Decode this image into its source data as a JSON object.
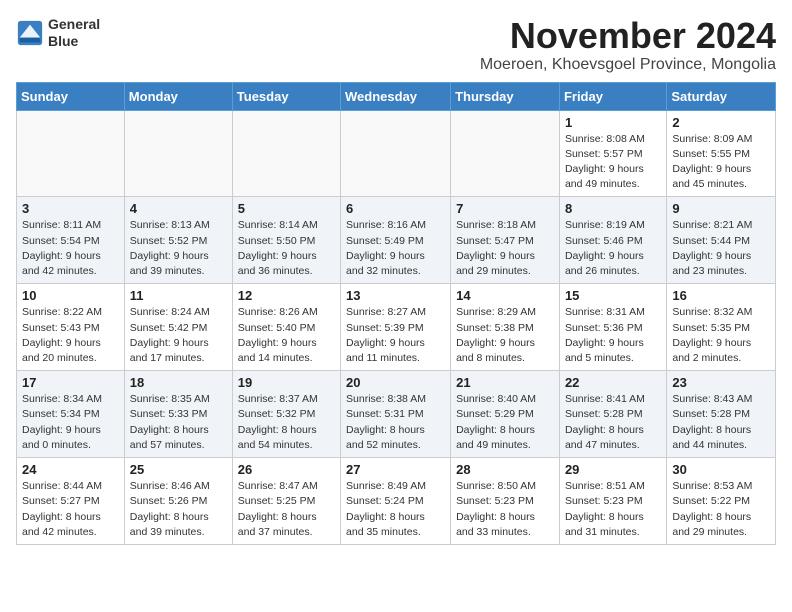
{
  "header": {
    "logo_line1": "General",
    "logo_line2": "Blue",
    "month_title": "November 2024",
    "subtitle": "Moeroen, Khoevsgoel Province, Mongolia"
  },
  "weekdays": [
    "Sunday",
    "Monday",
    "Tuesday",
    "Wednesday",
    "Thursday",
    "Friday",
    "Saturday"
  ],
  "weeks": [
    [
      {
        "day": "",
        "info": "",
        "empty": true
      },
      {
        "day": "",
        "info": "",
        "empty": true
      },
      {
        "day": "",
        "info": "",
        "empty": true
      },
      {
        "day": "",
        "info": "",
        "empty": true
      },
      {
        "day": "",
        "info": "",
        "empty": true
      },
      {
        "day": "1",
        "info": "Sunrise: 8:08 AM\nSunset: 5:57 PM\nDaylight: 9 hours and 49 minutes."
      },
      {
        "day": "2",
        "info": "Sunrise: 8:09 AM\nSunset: 5:55 PM\nDaylight: 9 hours and 45 minutes."
      }
    ],
    [
      {
        "day": "3",
        "info": "Sunrise: 8:11 AM\nSunset: 5:54 PM\nDaylight: 9 hours and 42 minutes."
      },
      {
        "day": "4",
        "info": "Sunrise: 8:13 AM\nSunset: 5:52 PM\nDaylight: 9 hours and 39 minutes."
      },
      {
        "day": "5",
        "info": "Sunrise: 8:14 AM\nSunset: 5:50 PM\nDaylight: 9 hours and 36 minutes."
      },
      {
        "day": "6",
        "info": "Sunrise: 8:16 AM\nSunset: 5:49 PM\nDaylight: 9 hours and 32 minutes."
      },
      {
        "day": "7",
        "info": "Sunrise: 8:18 AM\nSunset: 5:47 PM\nDaylight: 9 hours and 29 minutes."
      },
      {
        "day": "8",
        "info": "Sunrise: 8:19 AM\nSunset: 5:46 PM\nDaylight: 9 hours and 26 minutes."
      },
      {
        "day": "9",
        "info": "Sunrise: 8:21 AM\nSunset: 5:44 PM\nDaylight: 9 hours and 23 minutes."
      }
    ],
    [
      {
        "day": "10",
        "info": "Sunrise: 8:22 AM\nSunset: 5:43 PM\nDaylight: 9 hours and 20 minutes."
      },
      {
        "day": "11",
        "info": "Sunrise: 8:24 AM\nSunset: 5:42 PM\nDaylight: 9 hours and 17 minutes."
      },
      {
        "day": "12",
        "info": "Sunrise: 8:26 AM\nSunset: 5:40 PM\nDaylight: 9 hours and 14 minutes."
      },
      {
        "day": "13",
        "info": "Sunrise: 8:27 AM\nSunset: 5:39 PM\nDaylight: 9 hours and 11 minutes."
      },
      {
        "day": "14",
        "info": "Sunrise: 8:29 AM\nSunset: 5:38 PM\nDaylight: 9 hours and 8 minutes."
      },
      {
        "day": "15",
        "info": "Sunrise: 8:31 AM\nSunset: 5:36 PM\nDaylight: 9 hours and 5 minutes."
      },
      {
        "day": "16",
        "info": "Sunrise: 8:32 AM\nSunset: 5:35 PM\nDaylight: 9 hours and 2 minutes."
      }
    ],
    [
      {
        "day": "17",
        "info": "Sunrise: 8:34 AM\nSunset: 5:34 PM\nDaylight: 9 hours and 0 minutes."
      },
      {
        "day": "18",
        "info": "Sunrise: 8:35 AM\nSunset: 5:33 PM\nDaylight: 8 hours and 57 minutes."
      },
      {
        "day": "19",
        "info": "Sunrise: 8:37 AM\nSunset: 5:32 PM\nDaylight: 8 hours and 54 minutes."
      },
      {
        "day": "20",
        "info": "Sunrise: 8:38 AM\nSunset: 5:31 PM\nDaylight: 8 hours and 52 minutes."
      },
      {
        "day": "21",
        "info": "Sunrise: 8:40 AM\nSunset: 5:29 PM\nDaylight: 8 hours and 49 minutes."
      },
      {
        "day": "22",
        "info": "Sunrise: 8:41 AM\nSunset: 5:28 PM\nDaylight: 8 hours and 47 minutes."
      },
      {
        "day": "23",
        "info": "Sunrise: 8:43 AM\nSunset: 5:28 PM\nDaylight: 8 hours and 44 minutes."
      }
    ],
    [
      {
        "day": "24",
        "info": "Sunrise: 8:44 AM\nSunset: 5:27 PM\nDaylight: 8 hours and 42 minutes."
      },
      {
        "day": "25",
        "info": "Sunrise: 8:46 AM\nSunset: 5:26 PM\nDaylight: 8 hours and 39 minutes."
      },
      {
        "day": "26",
        "info": "Sunrise: 8:47 AM\nSunset: 5:25 PM\nDaylight: 8 hours and 37 minutes."
      },
      {
        "day": "27",
        "info": "Sunrise: 8:49 AM\nSunset: 5:24 PM\nDaylight: 8 hours and 35 minutes."
      },
      {
        "day": "28",
        "info": "Sunrise: 8:50 AM\nSunset: 5:23 PM\nDaylight: 8 hours and 33 minutes."
      },
      {
        "day": "29",
        "info": "Sunrise: 8:51 AM\nSunset: 5:23 PM\nDaylight: 8 hours and 31 minutes."
      },
      {
        "day": "30",
        "info": "Sunrise: 8:53 AM\nSunset: 5:22 PM\nDaylight: 8 hours and 29 minutes."
      }
    ]
  ]
}
